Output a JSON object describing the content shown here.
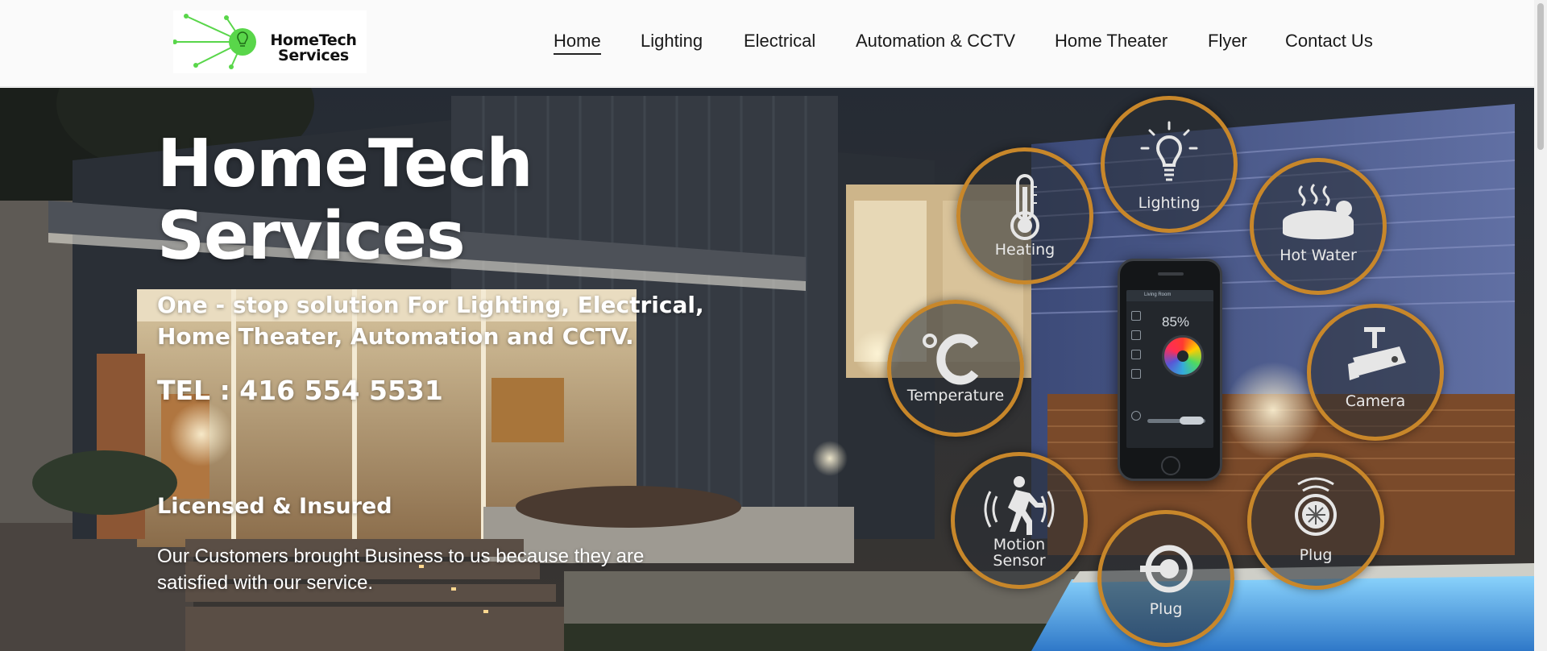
{
  "brand": {
    "logo_line1": "HomeTech",
    "logo_line2": "Services",
    "logo_green": "#59d64a"
  },
  "nav": {
    "items": [
      {
        "label": "Home",
        "active": true
      },
      {
        "label": "Lighting"
      },
      {
        "label": "Electrical"
      },
      {
        "label": "Automation & CCTV"
      },
      {
        "label": "Home Theater"
      },
      {
        "label": "Flyer"
      },
      {
        "label": "Contact Us"
      }
    ]
  },
  "hero": {
    "title_line1": "HomeTech",
    "title_line2": "Services",
    "subtitle": "One - stop solution For Lighting, Electrical, Home Theater, Automation and CCTV.",
    "tel": "TEL : 416 554 5531",
    "licensed": "Licensed & Insured",
    "description": "Our Customers brought Business to us because they are satisfied with our service."
  },
  "features": [
    {
      "label": "Heating",
      "icon": "thermometer-icon"
    },
    {
      "label": "Lighting",
      "icon": "lightbulb-icon"
    },
    {
      "label": "Hot Water",
      "icon": "hot-tub-icon"
    },
    {
      "label": "Temperature",
      "icon": "celsius-icon"
    },
    {
      "label": "Camera",
      "icon": "security-camera-icon"
    },
    {
      "label": "Motion",
      "label2": "Sensor",
      "icon": "motion-sensor-icon"
    },
    {
      "label": "Plug",
      "icon": "power-plug-icon"
    },
    {
      "label": "Plug",
      "icon": "smart-plug-icon"
    }
  ],
  "phone": {
    "title": "Living Room",
    "dimmer_percent": "85%"
  },
  "colors": {
    "ring": "#c8872a",
    "text_light": "#ffffff",
    "nav_text": "#1a1a1a"
  }
}
